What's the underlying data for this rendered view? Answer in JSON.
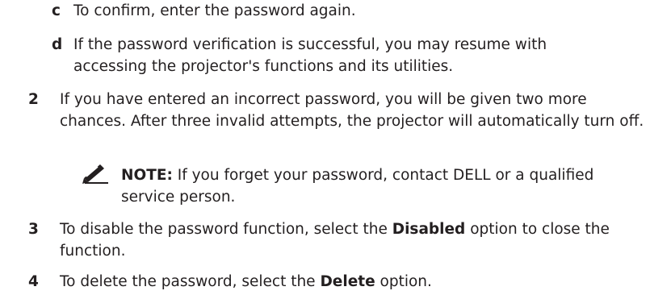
{
  "steps": {
    "c": {
      "label": "c",
      "text": "To confirm, enter the password again."
    },
    "d": {
      "label": "d",
      "text": "If the password verification is successful, you may resume with accessing the projector's functions and its utilities."
    },
    "s2": {
      "label": "2",
      "text": "If you have entered an incorrect password, you will be given two more chances. After three invalid attempts, the projector will automatically turn off."
    },
    "note": {
      "icon": "pencil-note-icon",
      "head": "NOTE:",
      "text": " If you forget your password, contact DELL or a qualified service person."
    },
    "s3": {
      "label": "3",
      "pre": "To disable the password function, select the ",
      "bold": "Disabled",
      "post": " option to close the function."
    },
    "s4": {
      "label": "4",
      "pre": "To delete the password, select the ",
      "bold": "Delete",
      "post": " option."
    }
  }
}
